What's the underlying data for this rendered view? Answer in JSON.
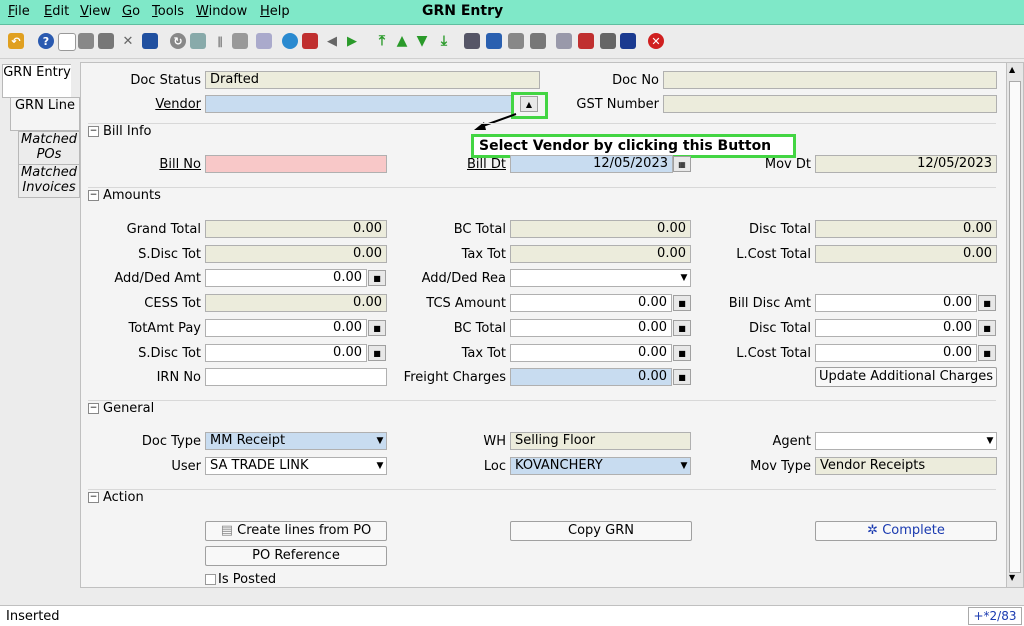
{
  "menu": {
    "items": [
      "File",
      "Edit",
      "View",
      "Go",
      "Tools",
      "Window",
      "Help"
    ],
    "title": "GRN Entry"
  },
  "tabs": {
    "grn_entry": "GRN Entry",
    "grn_line": "GRN Line",
    "matched_pos": "Matched POs",
    "matched_invoices": "Matched Invoices"
  },
  "header": {
    "doc_status_label": "Doc Status",
    "doc_status": "Drafted",
    "doc_no_label": "Doc No",
    "doc_no": "",
    "vendor_label": "Vendor",
    "vendor": "",
    "gst_label": "GST Number",
    "gst": ""
  },
  "callout": "Select Vendor by clicking this Button",
  "bill_info": {
    "title": "Bill Info",
    "bill_no_label": "Bill No",
    "bill_no": "",
    "bill_dt_label": "Bill Dt",
    "bill_dt": "12/05/2023",
    "mov_dt_label": "Mov Dt",
    "mov_dt": "12/05/2023"
  },
  "amounts": {
    "title": "Amounts",
    "grand_total_label": "Grand Total",
    "grand_total": "0.00",
    "bc_total_label": "BC Total",
    "bc_total": "0.00",
    "disc_total_label": "Disc Total",
    "disc_total": "0.00",
    "sdisc_tot_label": "S.Disc Tot",
    "sdisc_tot": "0.00",
    "tax_tot_label": "Tax Tot",
    "tax_tot": "0.00",
    "lcost_total_label": "L.Cost Total",
    "lcost_total": "0.00",
    "add_ded_amt_label": "Add/Ded Amt",
    "add_ded_amt": "0.00",
    "add_ded_rea_label": "Add/Ded Rea",
    "add_ded_rea": "",
    "cess_tot_label": "CESS Tot",
    "cess_tot": "0.00",
    "tcs_amount_label": "TCS Amount",
    "tcs_amount": "0.00",
    "bill_disc_amt_label": "Bill Disc Amt",
    "bill_disc_amt": "0.00",
    "totamt_pay_label": "TotAmt Pay",
    "totamt_pay": "0.00",
    "bc_total2_label": "BC Total",
    "bc_total2": "0.00",
    "disc_total2_label": "Disc Total",
    "disc_total2": "0.00",
    "sdisc_tot2_label": "S.Disc Tot",
    "sdisc_tot2": "0.00",
    "tax_tot2_label": "Tax Tot",
    "tax_tot2": "0.00",
    "lcost_total2_label": "L.Cost Total",
    "lcost_total2": "0.00",
    "irn_no_label": "IRN No",
    "irn_no": "",
    "freight_label": "Freight Charges",
    "freight": "0.00",
    "update_btn": "Update Additional Charges"
  },
  "general": {
    "title": "General",
    "doc_type_label": "Doc Type",
    "doc_type": "MM Receipt",
    "wh_label": "WH",
    "wh": "Selling Floor",
    "agent_label": "Agent",
    "agent": "",
    "user_label": "User",
    "user": "SA TRADE LINK",
    "loc_label": "Loc",
    "loc": "KOVANCHERY",
    "mov_type_label": "Mov Type",
    "mov_type": "Vendor Receipts"
  },
  "action": {
    "title": "Action",
    "create_lines": "Create lines from PO",
    "copy_grn": "Copy GRN",
    "complete": "Complete",
    "po_reference": "PO Reference",
    "is_posted": "Is Posted"
  },
  "status": {
    "text": "Inserted",
    "record": "+*2/83"
  }
}
